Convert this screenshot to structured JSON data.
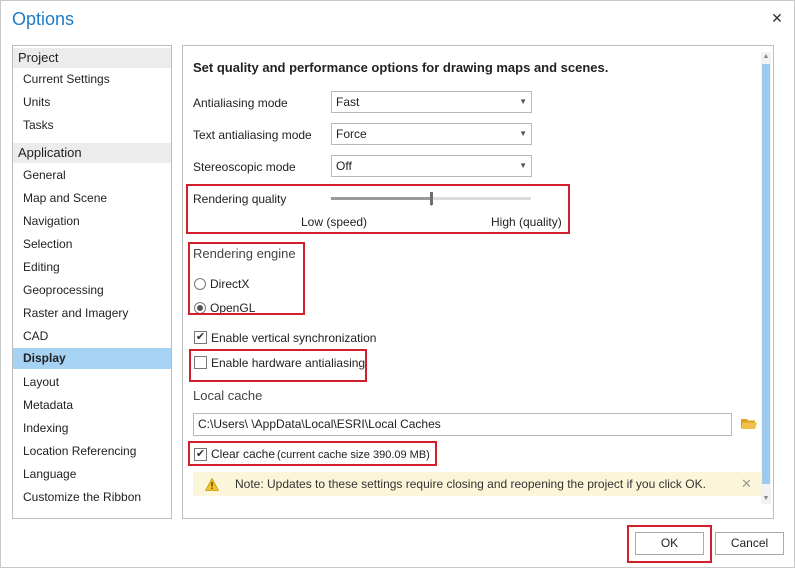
{
  "window": {
    "title": "Options"
  },
  "nav": {
    "groups": [
      {
        "label": "Project",
        "items": [
          "Current Settings",
          "Units",
          "Tasks"
        ]
      },
      {
        "label": "Application",
        "items": [
          "General",
          "Map and Scene",
          "Navigation",
          "Selection",
          "Editing",
          "Geoprocessing",
          "Raster and Imagery",
          "CAD",
          "Display",
          "Layout",
          "Metadata",
          "Indexing",
          "Location Referencing",
          "Language",
          "Customize the Ribbon"
        ]
      }
    ],
    "selected": "Display"
  },
  "display": {
    "heading": "Set quality and performance options for drawing maps and scenes.",
    "antialiasing": {
      "label": "Antialiasing mode",
      "value": "Fast"
    },
    "text_antialiasing": {
      "label": "Text antialiasing mode",
      "value": "Force"
    },
    "stereoscopic": {
      "label": "Stereoscopic mode",
      "value": "Off"
    },
    "rendering_quality": {
      "label": "Rendering quality",
      "low_label": "Low (speed)",
      "high_label": "High (quality)",
      "level": 0.5
    },
    "rendering_engine": {
      "label": "Rendering engine",
      "directx": "DirectX",
      "opengl": "OpenGL",
      "selected": "OpenGL"
    },
    "vsync": {
      "label": "Enable vertical synchronization",
      "checked": true
    },
    "hw_antialiasing": {
      "label": "Enable hardware antialiasing",
      "checked": false
    },
    "local_cache": {
      "label": "Local cache",
      "path": "C:\\Users\\                              \\AppData\\Local\\ESRI\\Local Caches",
      "clear_label": "Clear cache",
      "clear_size": "(current cache size 390.09 MB)",
      "clear_checked": true
    },
    "note": "Note:  Updates to these settings require closing and reopening the project if you click OK."
  },
  "buttons": {
    "ok": "OK",
    "cancel": "Cancel"
  },
  "colors": {
    "accent": "#1e7bc6",
    "selected_nav": "#a6d2f4",
    "highlight": "#d11f2b",
    "note_bg": "#fbf6d9"
  },
  "icons": [
    "close-icon",
    "dropdown-arrow-icon",
    "folder-icon",
    "warning-icon",
    "dismiss-icon",
    "check-icon"
  ]
}
